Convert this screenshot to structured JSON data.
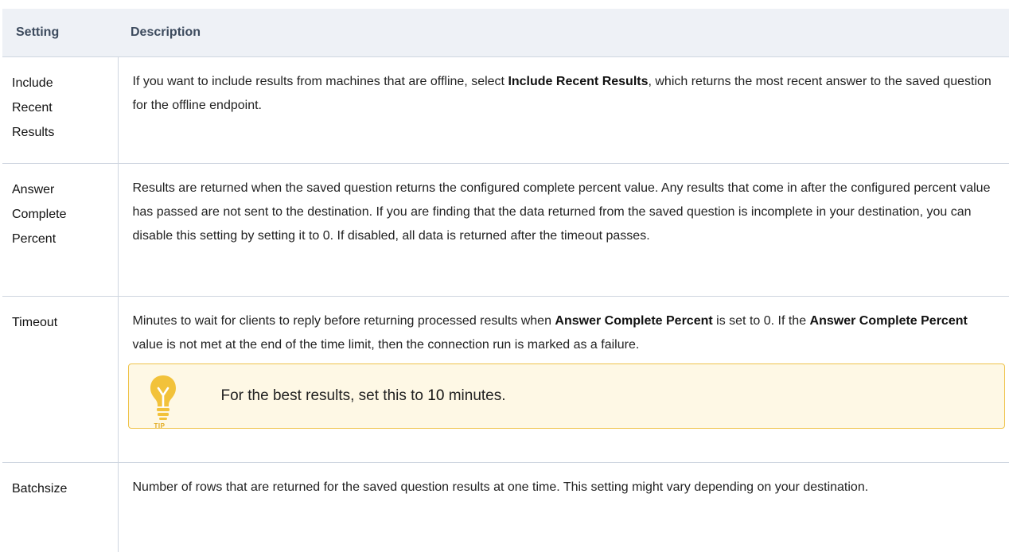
{
  "headers": {
    "setting": "Setting",
    "description": "Description"
  },
  "rows": {
    "include": {
      "name_lines": [
        "Include",
        "Recent",
        "Results"
      ],
      "desc_part1": "If you want to include results from machines that are offline, select ",
      "desc_bold": "Include Recent Results",
      "desc_part2": ", which returns the most recent answer to the saved question for the offline endpoint."
    },
    "answer": {
      "name_lines": [
        "Answer",
        "Complete",
        "Percent"
      ],
      "desc": "Results are returned when the saved question returns the configured complete percent value. Any results that come in after the configured percent value has passed are not sent to the destination. If you are finding that the data returned from the saved question is incomplete in your destination, you can disable this setting by setting it to 0. If disabled, all data is returned after the timeout passes."
    },
    "timeout": {
      "name": "Timeout",
      "desc_part1": "Minutes to wait for clients to reply before returning processed results when ",
      "desc_bold1": "Answer Complete Percent",
      "desc_part2": " is set to 0. If the ",
      "desc_bold2": "Answer Complete Percent",
      "desc_part3": " value is not met at the end of the time limit, then the connection run is marked as a failure."
    },
    "batchsize": {
      "name": "Batchsize",
      "desc": "Number of rows that are returned for the saved question results at one time. This setting might vary depending on your destination."
    }
  },
  "tip": {
    "icon": "lightbulb-icon",
    "label": "TIP",
    "text_part1": "For the best results, set this to ",
    "text_bold": "10",
    "text_part2": " minutes."
  },
  "colors": {
    "header_bg": "#eef1f6",
    "header_text": "#3d4b5e",
    "border": "#cfd6e0",
    "tip_bg": "#fef8e5",
    "tip_border": "#efc34a",
    "tip_icon": "#f2c23a"
  }
}
